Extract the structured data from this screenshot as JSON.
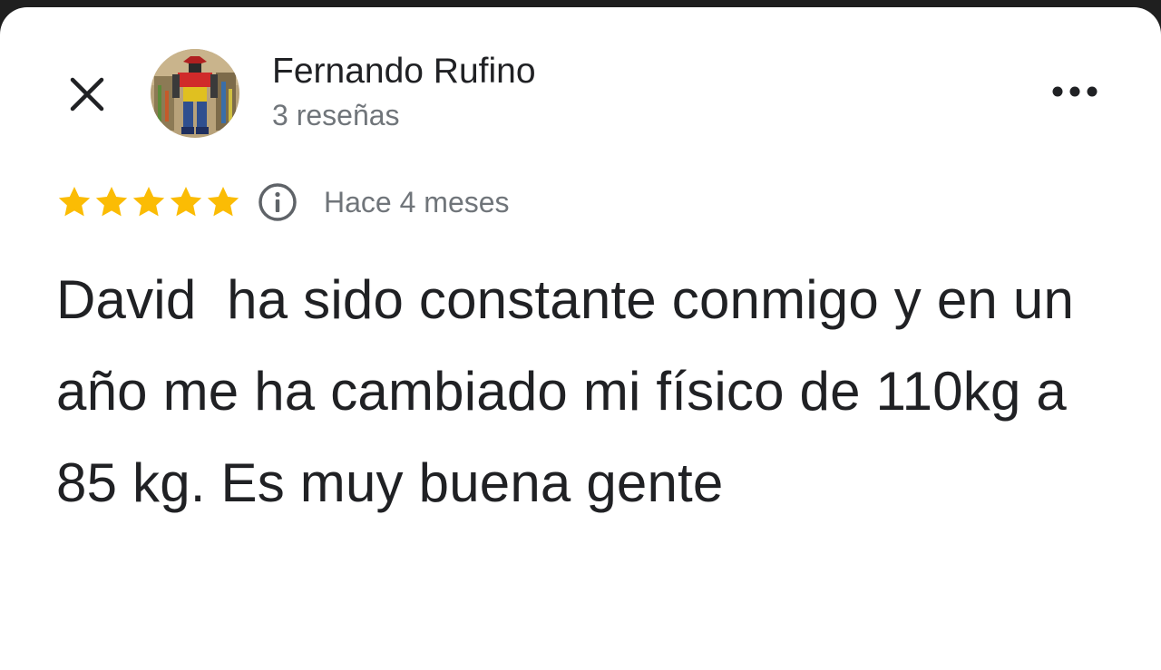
{
  "header": {
    "close_icon": "close-icon",
    "avatar_icon": "avatar-image",
    "author_name": "Fernando Rufino",
    "author_meta": "3 reseñas",
    "more_icon": "more-horizontal-icon"
  },
  "review": {
    "rating": 5,
    "rating_max": 5,
    "star_color": "#fbbc04",
    "info_icon": "info-icon",
    "date": "Hace 4 meses",
    "text": "David  ha sido constante conmigo y en un año me ha cambiado mi físico de 110kg a 85 kg. Es muy buena gente"
  }
}
